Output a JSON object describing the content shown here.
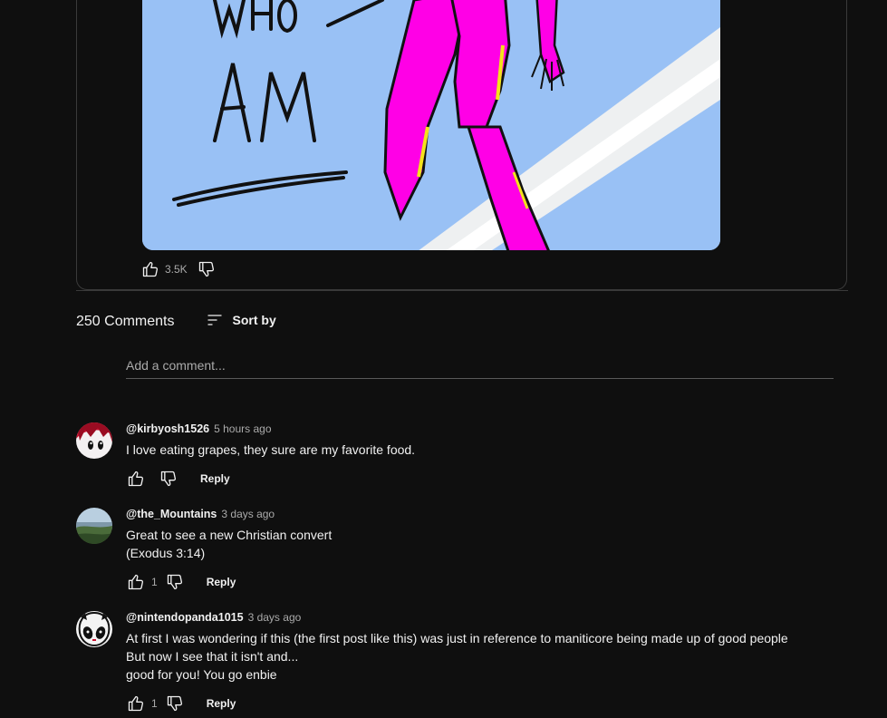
{
  "post": {
    "image_text": [
      "WHO I",
      "AM"
    ],
    "like_count": "3.5K"
  },
  "comments_section": {
    "count_label": "250 Comments",
    "sort_label": "Sort by",
    "add_comment_placeholder": "Add a comment..."
  },
  "comments": [
    {
      "author": "@kirbyosh1526",
      "time": "5 hours ago",
      "lines": [
        "I love eating grapes, they sure are my favorite food."
      ],
      "likes": "",
      "reply_label": "Reply"
    },
    {
      "author": "@the_Mountains",
      "time": "3 days ago",
      "lines": [
        "Great to see a new Christian convert",
        "(Exodus 3:14)"
      ],
      "likes": "1",
      "reply_label": "Reply"
    },
    {
      "author": "@nintendopanda1015",
      "time": "3 days ago",
      "lines": [
        "At first I was wondering if this (the first post like this) was just in reference to maniticore being made up of good people",
        "But now I see that it isn't and...",
        "good for you! You go enbie"
      ],
      "likes": "1",
      "reply_label": "Reply"
    }
  ],
  "icons": {
    "like": "thumbs-up-icon",
    "dislike": "thumbs-down-icon",
    "sort": "sort-icon"
  },
  "colors": {
    "background": "#0f0f0f",
    "text": "#f1f1f1",
    "secondary_text": "#aaaaaa",
    "image_sky": "#99c1f5",
    "figure_magenta": "#ff00e6"
  }
}
